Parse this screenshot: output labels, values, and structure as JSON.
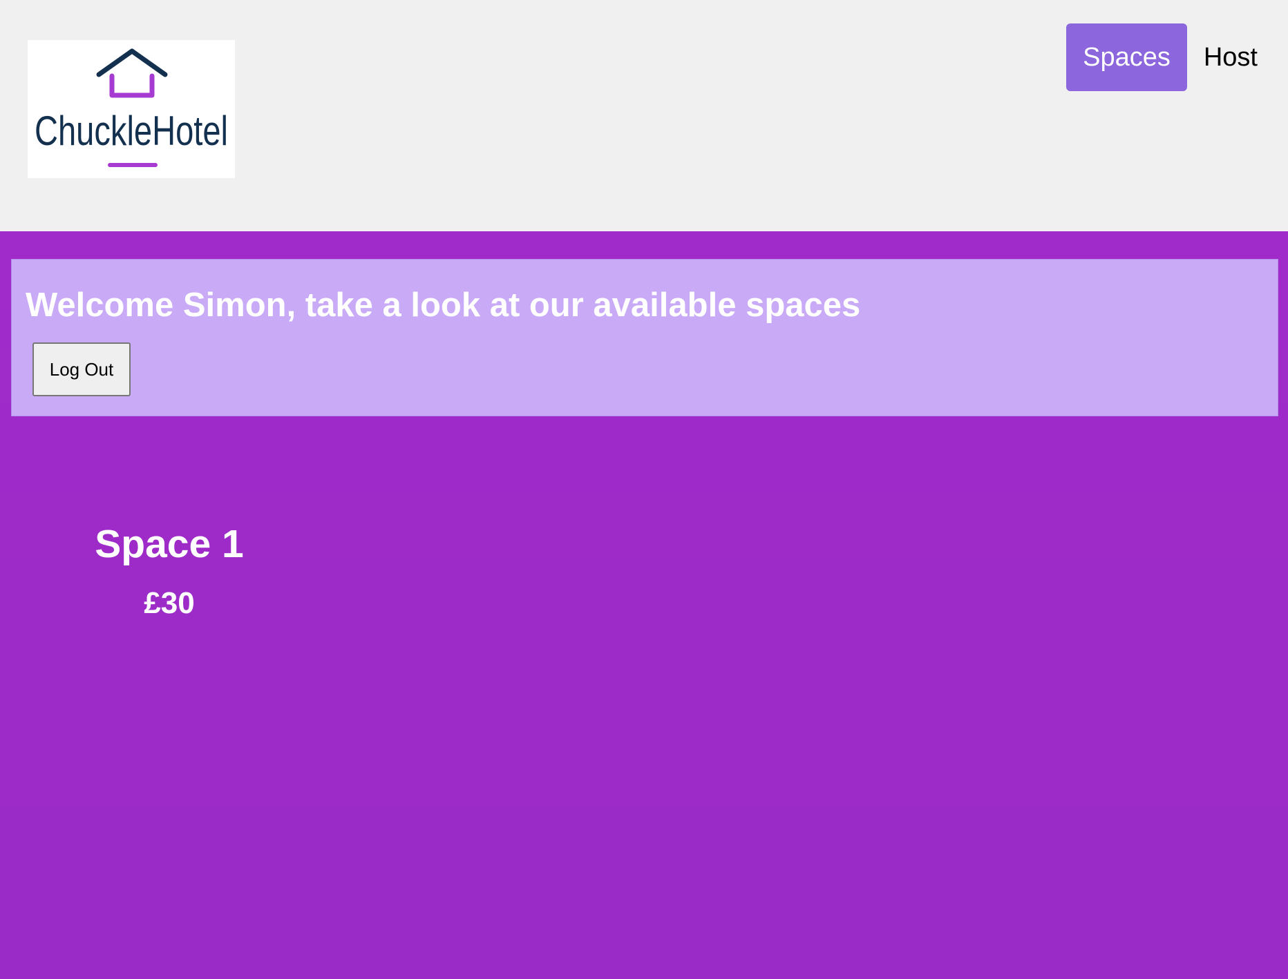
{
  "brand": {
    "logo_text": "ChuckleHotel",
    "colors": {
      "navy": "#14304f",
      "purple": "#a63bd2"
    }
  },
  "nav": {
    "items": [
      {
        "label": "Spaces",
        "active": true
      },
      {
        "label": "Host",
        "active": false
      }
    ]
  },
  "welcome": {
    "title": "Welcome Simon, take a look at our available spaces",
    "logout_label": "Log Out"
  },
  "spaces": [
    {
      "name": "Space 1",
      "price": "£30"
    }
  ],
  "colors": {
    "header_bg": "#f0f0f0",
    "page_bg": "#9b2bc7",
    "panel_bg": "#c8aaf7",
    "nav_active_bg": "#8c66dc"
  }
}
